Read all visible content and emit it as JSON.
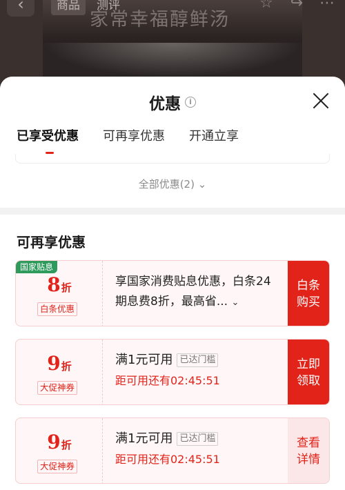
{
  "background": {
    "product_title": "家常幸福醇鲜汤",
    "nav_tabs": [
      "商品",
      "测评"
    ],
    "icons": [
      "back-icon",
      "star-icon",
      "share-icon",
      "more-icon"
    ]
  },
  "sheet": {
    "title": "优惠",
    "tabs": [
      {
        "label": "已享受优惠"
      },
      {
        "label": "可再享优惠"
      },
      {
        "label": "开通立享"
      }
    ],
    "all_offers_label": "全部优惠(2)"
  },
  "section": {
    "title": "可再享优惠",
    "coupons": [
      {
        "corner": "国家贴息",
        "discount": "8",
        "unit": "折",
        "tag": "白条优惠",
        "desc": "享国家消费贴息优惠，白条24期息费8折，最高省...",
        "action": "白条\n购买"
      },
      {
        "discount": "9",
        "unit": "折",
        "tag": "大促神券",
        "condition": "满1元可用",
        "reach": "已达门槛",
        "countdown": "距可用还有02:45:51",
        "action": "立即\n领取"
      },
      {
        "discount": "9",
        "unit": "折",
        "tag": "大促神券",
        "condition": "满1元可用",
        "reach": "已达门槛",
        "countdown": "距可用还有02:45:51",
        "action": "查看\n详情"
      }
    ]
  },
  "colors": {
    "accent": "#e2231a",
    "tag_green": "#2e9b5d"
  }
}
